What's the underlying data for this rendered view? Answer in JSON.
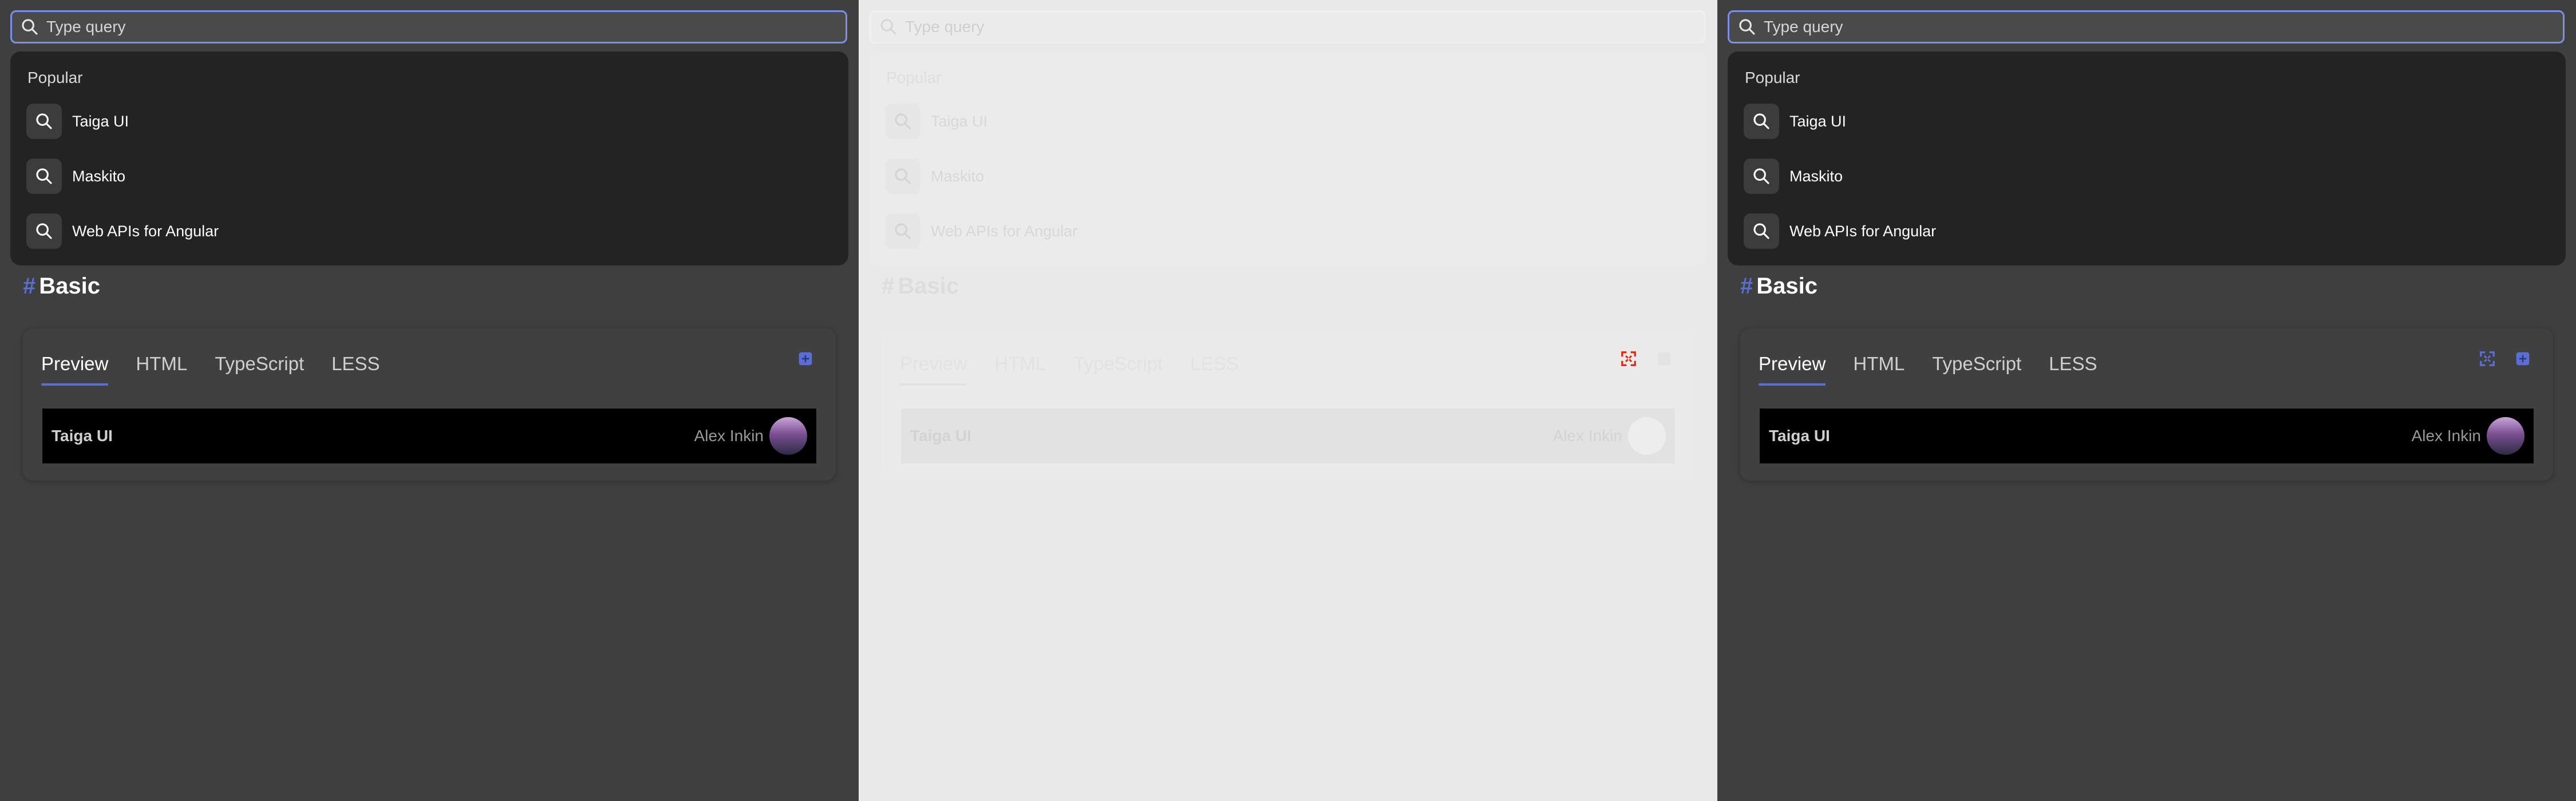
{
  "search": {
    "placeholder": "Type query"
  },
  "dropdown": {
    "section": "Popular",
    "items": [
      {
        "label": "Taiga UI"
      },
      {
        "label": "Maskito"
      },
      {
        "label": "Web APIs for Angular"
      }
    ]
  },
  "heading": {
    "hash": "#",
    "title": "Basic"
  },
  "card": {
    "tabs": [
      "Preview",
      "HTML",
      "TypeScript",
      "LESS"
    ],
    "demo": {
      "logo": "Taiga UI",
      "user": "Alex Inkin"
    }
  },
  "colors": {
    "accent": "#5a6fd6",
    "focus_border": "#7b8fe6",
    "fullscreen_icon": "#e02a10"
  }
}
